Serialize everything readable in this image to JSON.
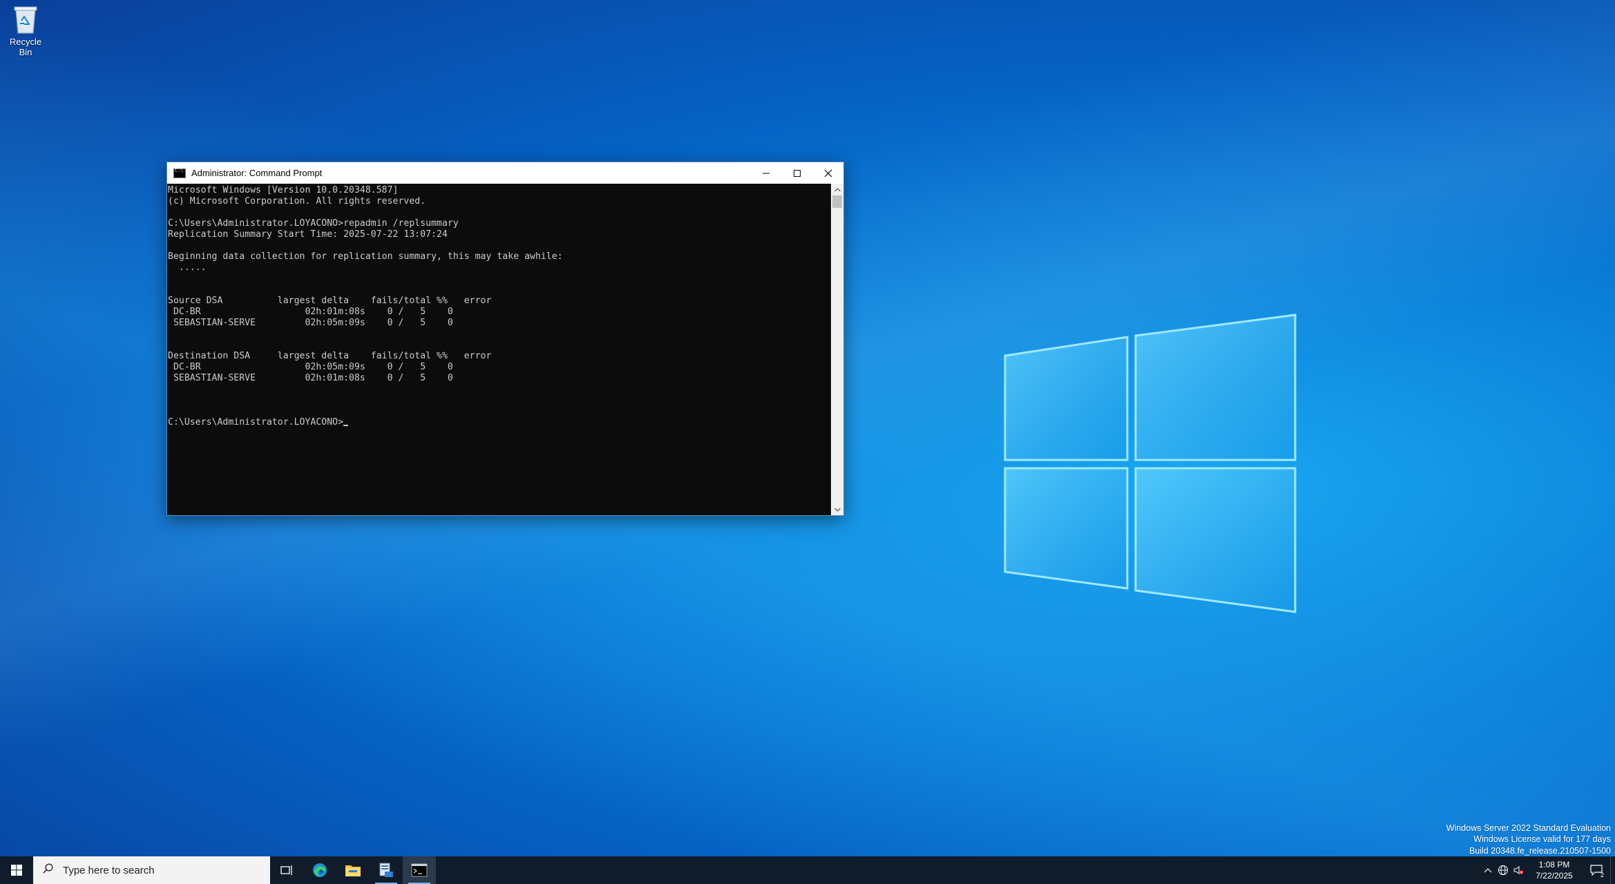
{
  "desktop": {
    "icons": [
      {
        "label": "Recycle Bin",
        "icon": "recycle-bin-icon"
      }
    ],
    "watermark": {
      "line1": "Windows Server 2022 Standard Evaluation",
      "line2": "Windows License valid for 177 days",
      "line3": "Build 20348.fe_release.210507-1500"
    }
  },
  "cmd_window": {
    "title": "Administrator: Command Prompt",
    "console_lines": [
      "Microsoft Windows [Version 10.0.20348.587]",
      "(c) Microsoft Corporation. All rights reserved.",
      "",
      "C:\\Users\\Administrator.LOYACONO>repadmin /replsummary",
      "Replication Summary Start Time: 2025-07-22 13:07:24",
      "",
      "Beginning data collection for replication summary, this may take awhile:",
      "  .....",
      "",
      "",
      "Source DSA          largest delta    fails/total %%   error",
      " DC-BR                   02h:01m:08s    0 /   5    0",
      " SEBASTIAN-SERVE         02h:05m:09s    0 /   5    0",
      "",
      "",
      "Destination DSA     largest delta    fails/total %%   error",
      " DC-BR                   02h:05m:09s    0 /   5    0",
      " SEBASTIAN-SERVE         02h:01m:08s    0 /   5    0",
      "",
      "",
      "",
      "C:\\Users\\Administrator.LOYACONO>"
    ]
  },
  "taskbar": {
    "search_placeholder": "Type here to search",
    "apps": [
      "task-view",
      "edge",
      "file-explorer",
      "server-manager",
      "command-prompt"
    ],
    "clock": {
      "time": "1:08 PM",
      "date": "7/22/2025"
    },
    "notification_count": "2"
  },
  "colors": {
    "taskbar_bg": "#101c2a",
    "console_bg": "#0c0c0c",
    "console_fg": "#cccccc",
    "desktop_accent": "#0a7fd8"
  }
}
